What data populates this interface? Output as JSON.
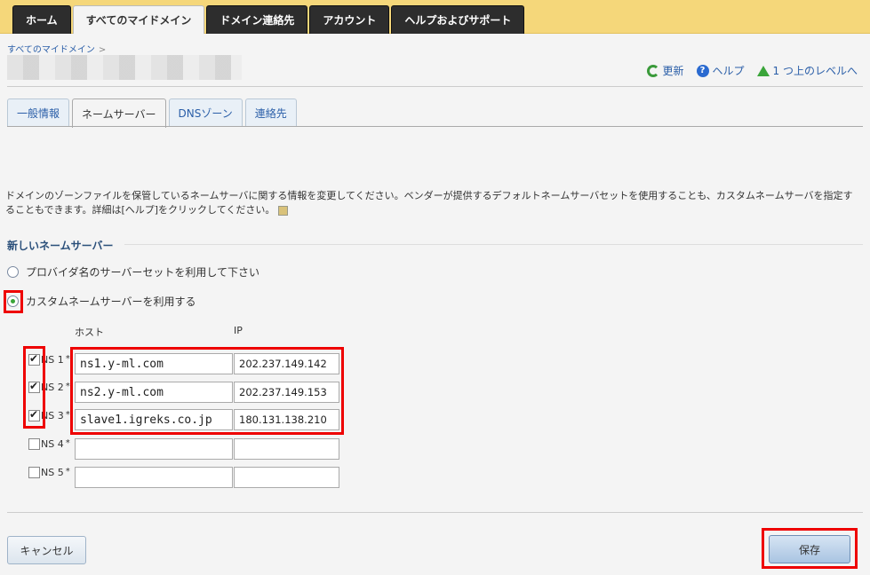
{
  "topnav": [
    {
      "label": "ホーム",
      "active": false
    },
    {
      "label": "すべてのマイドメイン",
      "active": true
    },
    {
      "label": "ドメイン連絡先",
      "active": false
    },
    {
      "label": "アカウント",
      "active": false
    },
    {
      "label": "ヘルプおよびサポート",
      "active": false
    }
  ],
  "breadcrumb": {
    "item": "すべてのマイドメイン",
    "separator": ">"
  },
  "actions": {
    "refresh": "更新",
    "help": "ヘルプ",
    "up": "1 つ上のレベルへ"
  },
  "subtabs": [
    {
      "label": "一般情報",
      "active": false
    },
    {
      "label": "ネームサーバー",
      "active": true
    },
    {
      "label": "DNSゾーン",
      "active": false
    },
    {
      "label": "連絡先",
      "active": false
    }
  ],
  "description": "ドメインのゾーンファイルを保管しているネームサーバに関する情報を変更してください。ベンダーが提供するデフォルトネームサーバセットを使用することも、カスタムネームサーバを指定することもできます。詳細は[ヘルプ]をクリックしてください。",
  "section_title": "新しいネームサーバー",
  "radios": [
    {
      "label": "プロバイダ名のサーバーセットを利用して下さい",
      "checked": false
    },
    {
      "label": "カスタムネームサーバーを利用する",
      "checked": true
    }
  ],
  "columns": {
    "host": "ホスト",
    "ip": "IP"
  },
  "nameservers": [
    {
      "label": "NS 1",
      "required": "*",
      "checked": true,
      "host": "ns1.y-ml.com",
      "ip": "202.237.149.142"
    },
    {
      "label": "NS 2",
      "required": "*",
      "checked": true,
      "host": "ns2.y-ml.com",
      "ip": "202.237.149.153"
    },
    {
      "label": "NS 3",
      "required": "*",
      "checked": true,
      "host": "slave1.igreks.co.jp",
      "ip": "180.131.138.210"
    },
    {
      "label": "NS 4",
      "required": "*",
      "checked": false,
      "host": "",
      "ip": ""
    },
    {
      "label": "NS 5",
      "required": "*",
      "checked": false,
      "host": "",
      "ip": ""
    }
  ],
  "buttons": {
    "cancel": "キャンセル",
    "save": "保存"
  },
  "colors": {
    "topbar": "#f5d77a",
    "link": "#2a5ea8",
    "highlight": "#e00000"
  }
}
